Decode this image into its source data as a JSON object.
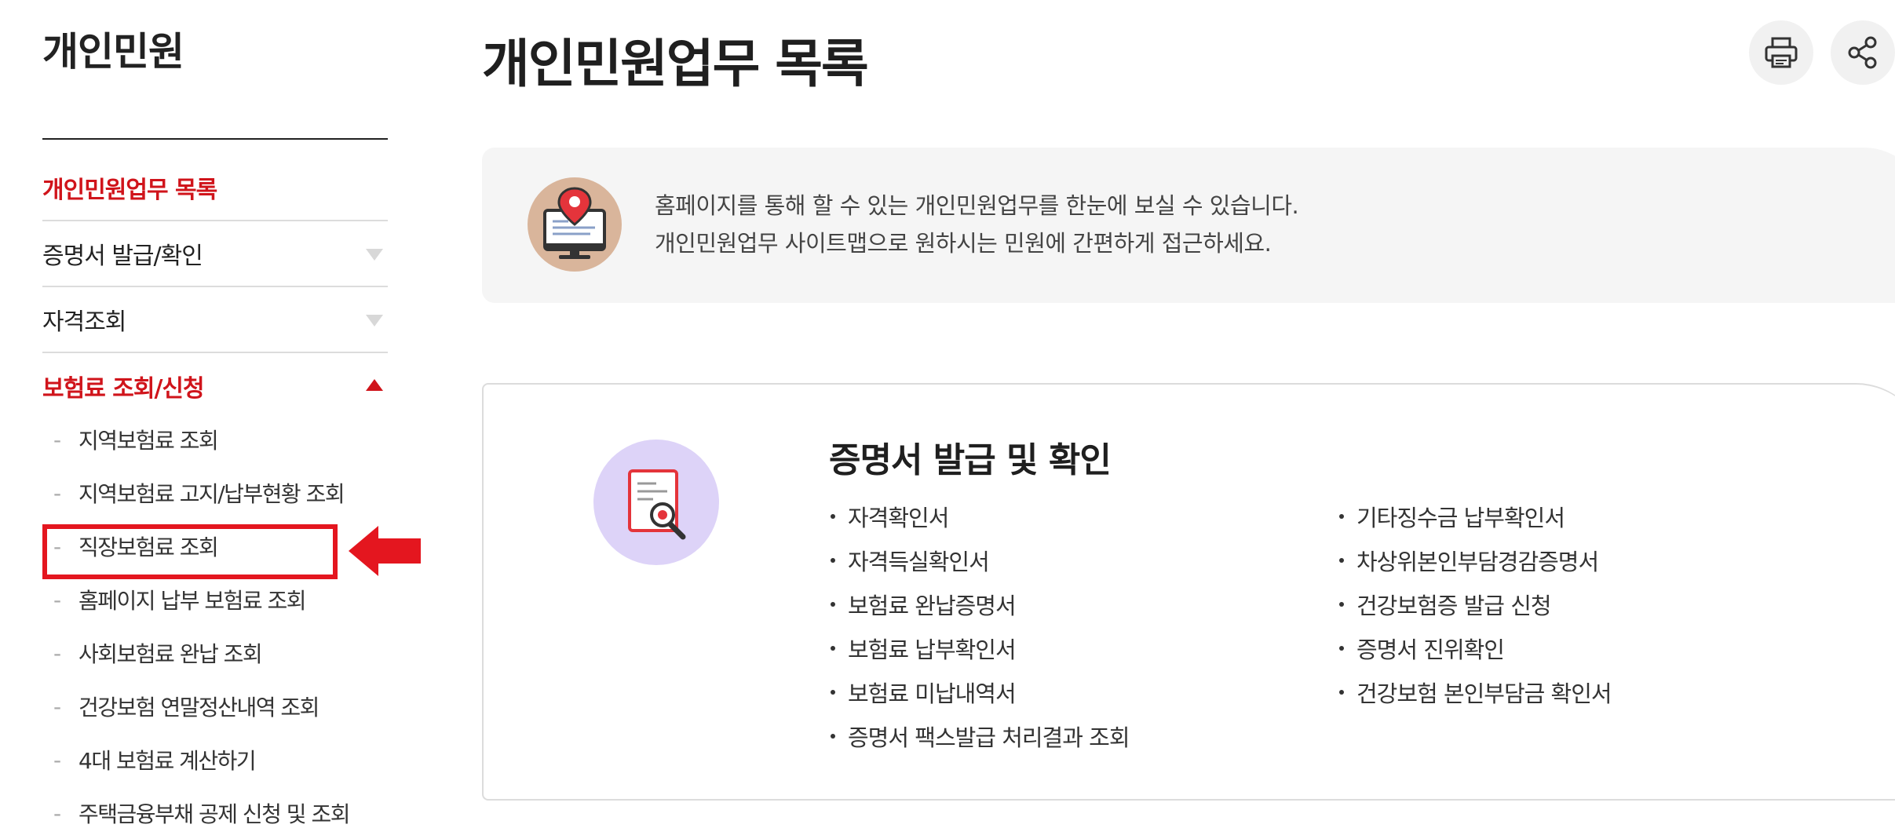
{
  "sidebar": {
    "title": "개인민원",
    "menu": [
      {
        "label": "개인민원업무 목록",
        "state": "active"
      },
      {
        "label": "증명서 발급/확인",
        "state": "collapsed"
      },
      {
        "label": "자격조회",
        "state": "collapsed"
      },
      {
        "label": "보험료 조회/신청",
        "state": "expanded"
      }
    ],
    "submenu": [
      {
        "label": "지역보험료 조회"
      },
      {
        "label": "지역보험료 고지/납부현황 조회"
      },
      {
        "label": "직장보험료 조회",
        "highlighted": true
      },
      {
        "label": "홈페이지 납부 보험료 조회"
      },
      {
        "label": "사회보험료 완납 조회"
      },
      {
        "label": "건강보험 연말정산내역 조회"
      },
      {
        "label": "4대 보험료 계산하기"
      },
      {
        "label": "주택금융부채 공제 신청 및 조회"
      }
    ],
    "dash": "-"
  },
  "main": {
    "title": "개인민원업무 목록",
    "tools": [
      {
        "icon": "print-icon"
      },
      {
        "icon": "share-icon"
      }
    ],
    "intro": {
      "icon": "monitor-location-icon",
      "line1": "홈페이지를 통해 할 수 있는 개인민원업무를 한눈에 보실 수 있습니다.",
      "line2": "개인민원업무 사이트맵으로 원하시는 민원에 간편하게 접근하세요."
    },
    "card": {
      "icon": "certificate-search-icon",
      "title": "증명서 발급 및 확인",
      "left_links": [
        "자격확인서",
        "자격득실확인서",
        "보험료 완납증명서",
        "보험료 납부확인서",
        "보험료 미납내역서",
        "증명서 팩스발급 처리결과 조회"
      ],
      "right_links": [
        "기타징수금 납부확인서",
        "차상위본인부담경감증명서",
        "건강보험증 발급 신청",
        "증명서 진위확인",
        "건강보험 본인부담금 확인서"
      ]
    }
  },
  "colors": {
    "accent_red": "#d0141b",
    "highlight_red": "#e4161f",
    "intro_bg": "#f5f5f5",
    "intro_icon_bg": "#d9b59b",
    "card_icon_bg": "#ddd3f8"
  }
}
